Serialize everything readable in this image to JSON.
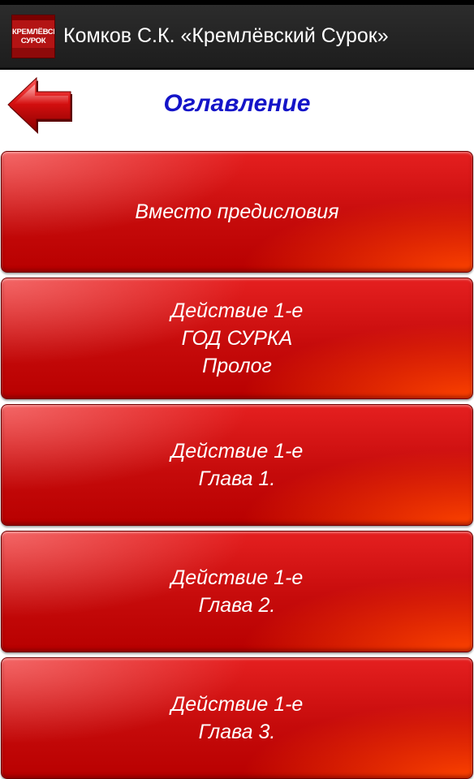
{
  "action_bar": {
    "app_icon_text": "КРЕМЛЁВСКИЙ\nСУРОК",
    "title": "Комков С.К. «Кремлёвский Сурок»"
  },
  "header": {
    "title": "Оглавление",
    "back_icon": "back-arrow-icon"
  },
  "toc": {
    "items": [
      {
        "label": "Вместо предисловия"
      },
      {
        "label": "Действие 1-е\nГОД СУРКА\nПролог"
      },
      {
        "label": "Действие 1-е\nГлава 1."
      },
      {
        "label": "Действие 1-е\nГлава 2."
      },
      {
        "label": "Действие 1-е\nГлава 3."
      }
    ]
  },
  "colors": {
    "action_bar_bg": "#1f1f1f",
    "header_title": "#1414c8",
    "item_red": "#c60b0b",
    "item_highlight": "#ff4600"
  }
}
